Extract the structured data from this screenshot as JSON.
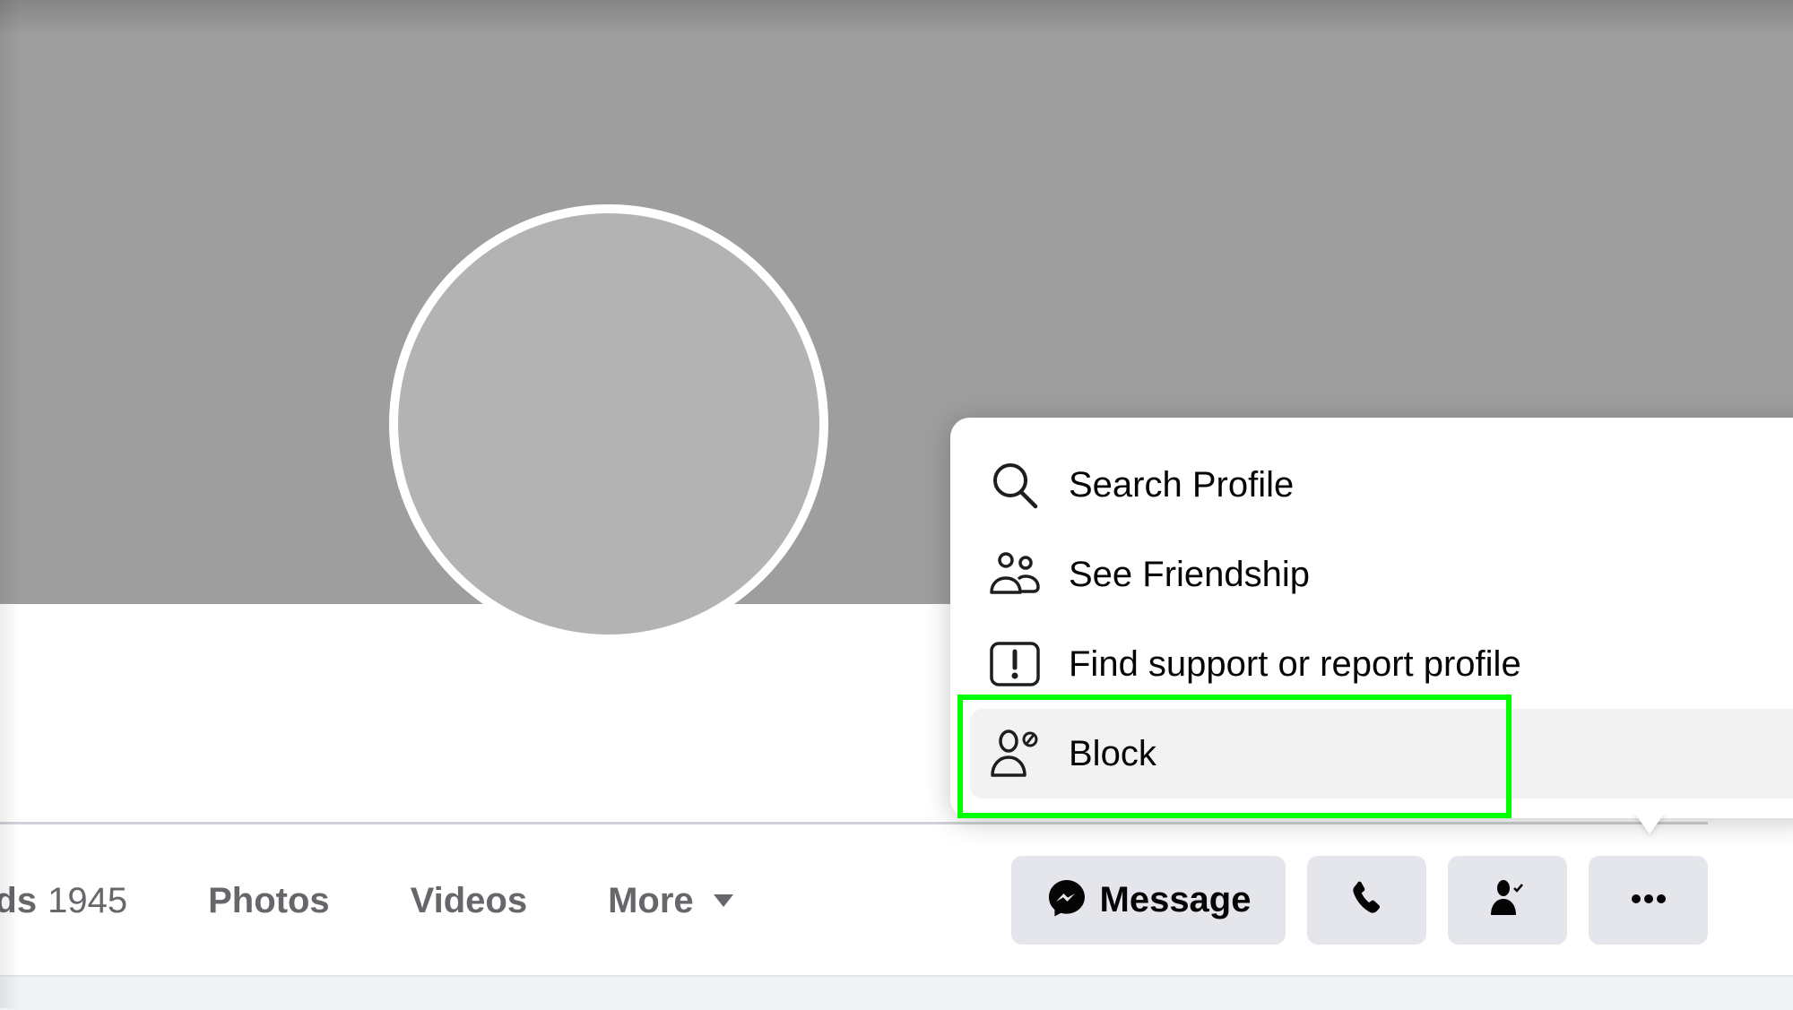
{
  "profile": {
    "cover_color": "#9e9e9e",
    "avatar_placeholder_color": "#b3b3b3"
  },
  "tabs": {
    "friends": {
      "label_visible": "nds",
      "count": "1945"
    },
    "photos": "Photos",
    "videos": "Videos",
    "more": "More"
  },
  "actions": {
    "message_label": "Message",
    "call_icon": "phone-icon",
    "friends_icon": "friend-check-icon",
    "more_icon": "ellipsis-icon"
  },
  "menu": {
    "items": [
      {
        "label": "Search Profile",
        "icon": "search-icon"
      },
      {
        "label": "See Friendship",
        "icon": "friends-icon"
      },
      {
        "label": "Find support or report profile",
        "icon": "report-icon"
      },
      {
        "label": "Block",
        "icon": "block-user-icon",
        "highlighted": true
      }
    ]
  },
  "annotation": {
    "highlight_color": "#00ff00",
    "target": "Block"
  }
}
